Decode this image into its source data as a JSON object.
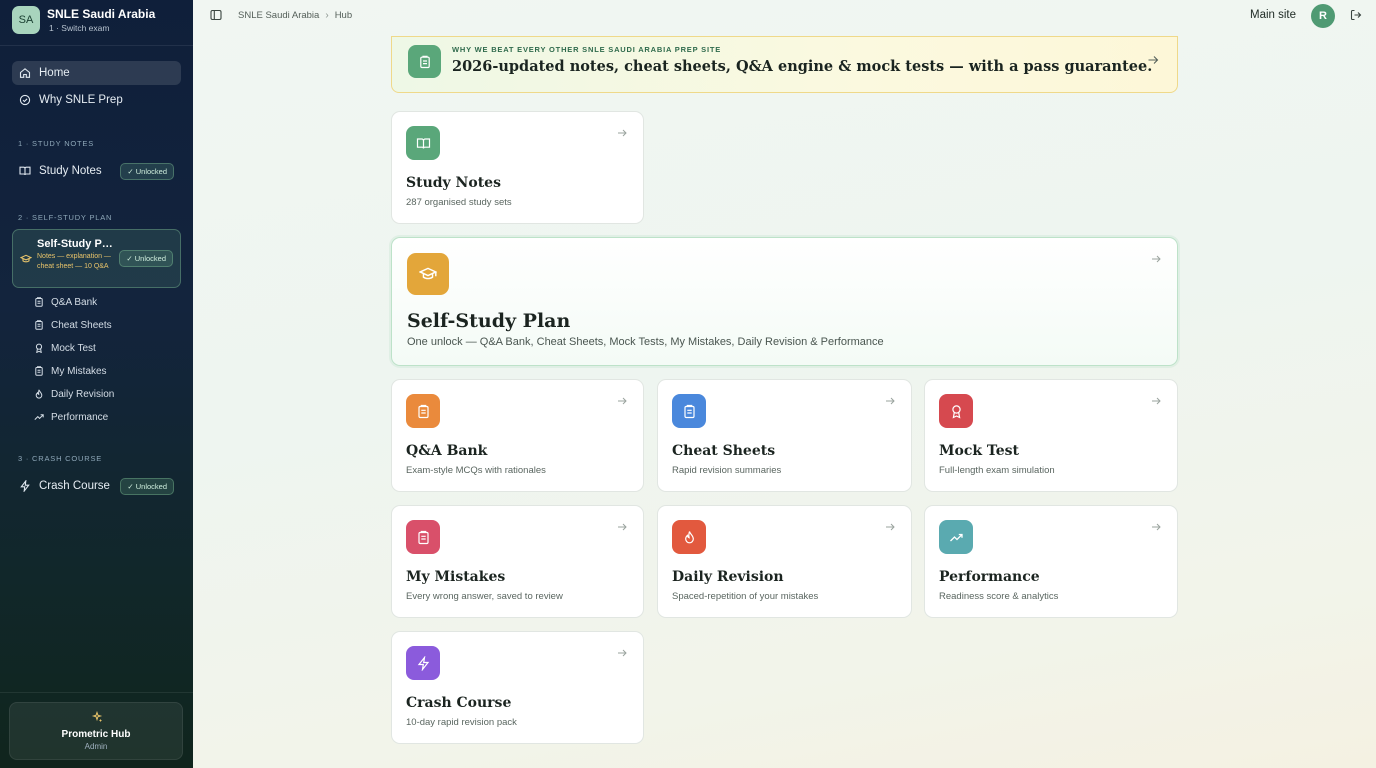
{
  "brand": {
    "initials": "SA",
    "title": "SNLE Saudi Arabia",
    "subtitle": "1 · Switch exam"
  },
  "sidebar": {
    "home_label": "Home",
    "why_label": "Why SNLE Prep",
    "section1_label": "1 · STUDY NOTES",
    "study_notes_label": "Study Notes",
    "study_notes_badge": "✓ Unlocked",
    "section2_label": "2 · SELF-STUDY PLAN",
    "plan_title": "Self-Study Plan",
    "plan_desc": "Notes — explanation — cheat sheet — 10 Q&A",
    "plan_badge": "✓ Unlocked",
    "sub_items": [
      "Q&A Bank",
      "Cheat Sheets",
      "Mock Test",
      "My Mistakes",
      "Daily Revision",
      "Performance"
    ],
    "section3_label": "3 · CRASH COURSE",
    "crash_label": "Crash Course",
    "crash_badge": "✓ Unlocked"
  },
  "account": {
    "name": "Prometric Hub",
    "role": "Admin"
  },
  "topbar": {
    "crumb_root": "SNLE Saudi Arabia",
    "crumb_current": "Hub",
    "main_site_label": "Main site",
    "user_initial": "R"
  },
  "banner": {
    "eyebrow": "WHY WE BEAT EVERY OTHER SNLE SAUDI ARABIA PREP SITE",
    "title": "2026-updated notes, cheat sheets, Q&A engine & mock tests — with a pass guarantee."
  },
  "cards": {
    "study_notes": {
      "title": "Study Notes",
      "desc": "287 organised study sets"
    },
    "self_study": {
      "title": "Self-Study Plan",
      "desc": "One unlock — Q&A Bank, Cheat Sheets, Mock Tests, My Mistakes, Daily Revision & Performance"
    },
    "qa_bank": {
      "title": "Q&A Bank",
      "desc": "Exam-style MCQs with rationales"
    },
    "cheat_sheets": {
      "title": "Cheat Sheets",
      "desc": "Rapid revision summaries"
    },
    "mock_test": {
      "title": "Mock Test",
      "desc": "Full-length exam simulation"
    },
    "my_mistakes": {
      "title": "My Mistakes",
      "desc": "Every wrong answer, saved to review"
    },
    "daily_revision": {
      "title": "Daily Revision",
      "desc": "Spaced-repetition of your mistakes"
    },
    "performance": {
      "title": "Performance",
      "desc": "Readiness score & analytics"
    },
    "crash_course": {
      "title": "Crash Course",
      "desc": "10-day rapid revision pack"
    }
  },
  "colors": {
    "sidebar_bg": "#10213a",
    "accent_green": "#5aa77a",
    "study_notes_icon": "#5aa77a",
    "self_study_icon": "#e3a63a",
    "qa_bank_icon": "#ea8a3c",
    "cheat_sheets_icon": "#4a88dc",
    "mock_test_icon": "#d6494f",
    "my_mistakes_icon": "#d9506a",
    "daily_revision_icon": "#e2593e",
    "performance_icon": "#5aaab0",
    "crash_course_icon": "#8b5bdc"
  }
}
